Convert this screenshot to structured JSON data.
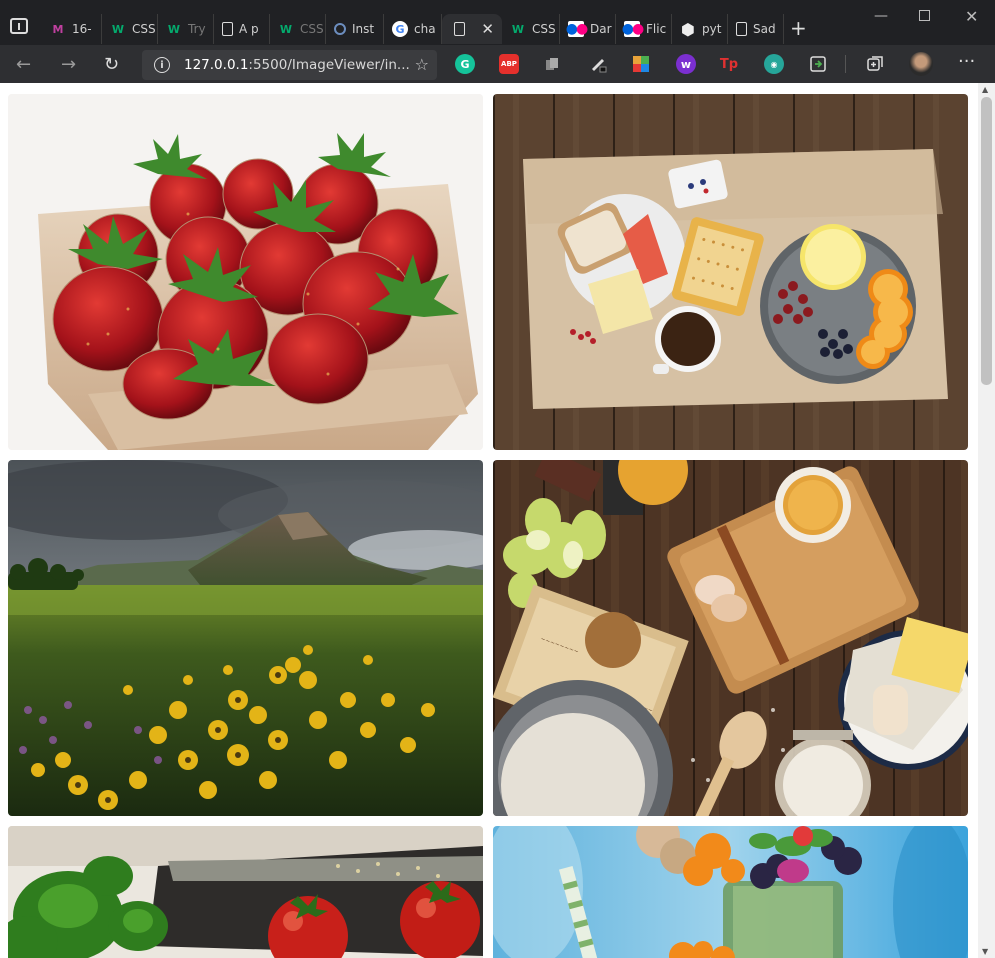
{
  "tabs": [
    {
      "label": "16-",
      "icon": "maroon-m-icon",
      "color": "#c040a0"
    },
    {
      "label": "CSS",
      "icon": "w3schools-icon",
      "color": "#04aa6d"
    },
    {
      "label": "Try",
      "icon": "w3schools-icon",
      "color": "#04aa6d"
    },
    {
      "label": "A p",
      "icon": "page-icon",
      "color": "#dddddd"
    },
    {
      "label": "CSS",
      "icon": "w3schools-icon",
      "color": "#04aa6d"
    },
    {
      "label": "Inst",
      "icon": "blue-circle-icon",
      "color": "#6c8ebf"
    },
    {
      "label": "cha",
      "icon": "google-icon",
      "color": "#4285f4"
    },
    {
      "label": "",
      "icon": "page-icon",
      "color": "#dddddd"
    },
    {
      "label": "CSS",
      "icon": "w3schools-icon",
      "color": "#04aa6d"
    },
    {
      "label": "Dar",
      "icon": "flickr-icon",
      "color": "#0063dc"
    },
    {
      "label": "Flic",
      "icon": "flickr-icon",
      "color": "#0063dc"
    },
    {
      "label": "pyt",
      "icon": "python-hex-icon",
      "color": "#dddddd"
    },
    {
      "label": "Sad",
      "icon": "page-icon",
      "color": "#dddddd"
    }
  ],
  "active_tab_index": 7,
  "address": {
    "host": "127.0.0.1",
    "rest": ":5500/ImageViewer/in..."
  },
  "extensions": [
    {
      "name": "grammarly-icon",
      "text": "G",
      "color": "#15c39a"
    },
    {
      "name": "adblock-icon",
      "text": "ABP",
      "color": "#e5302c"
    },
    {
      "name": "copy-icon",
      "text": "",
      "color": "#9a9a9a"
    },
    {
      "name": "pen-icon",
      "text": "",
      "color": "#dddddd"
    },
    {
      "name": "puzzle-color-icon",
      "text": "",
      "color": "#e8a33a"
    },
    {
      "name": "w-purple-icon",
      "text": "w",
      "color": "#7b2fd0"
    },
    {
      "name": "tp-icon",
      "text": "Tp",
      "color": "#e03131"
    },
    {
      "name": "eye-icon",
      "text": "",
      "color": "#26a69a"
    },
    {
      "name": "refresh-sync-icon",
      "text": "",
      "color": "#4caf50"
    }
  ],
  "photos": [
    {
      "name": "photo-strawberries",
      "alt": "strawberries"
    },
    {
      "name": "photo-breakfast",
      "alt": "breakfast"
    },
    {
      "name": "photo-mountain",
      "alt": "mountain"
    },
    {
      "name": "photo-baking",
      "alt": "baking"
    },
    {
      "name": "photo-tomatoes",
      "alt": "tomatoes"
    },
    {
      "name": "photo-smoothie",
      "alt": "smoothie"
    }
  ]
}
